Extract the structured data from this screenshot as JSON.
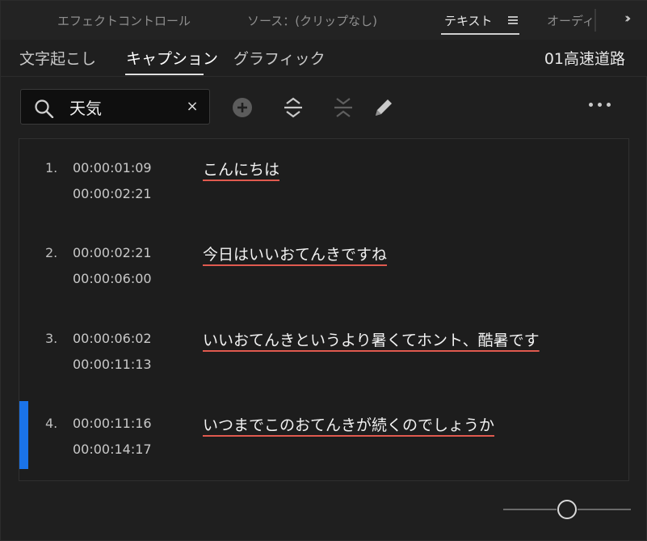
{
  "panel_tabs": {
    "items": [
      {
        "label": "エフェクトコントロール"
      },
      {
        "label": "ソース：(クリップなし)"
      },
      {
        "label": "テキスト"
      },
      {
        "label": "オーディ"
      }
    ],
    "active_index": 2
  },
  "sub_tabs": {
    "items": [
      {
        "label": "文字起こし"
      },
      {
        "label": "キャプション"
      },
      {
        "label": "グラフィック"
      }
    ],
    "active_index": 1
  },
  "sequence_name": "01高速道路",
  "search": {
    "value": "天気",
    "clear_glyph": "×"
  },
  "toolbar_icons": [
    "add-caption-icon",
    "split-caption-icon",
    "merge-captions-icon",
    "edit-icon",
    "more-options-icon"
  ],
  "captions": [
    {
      "num": "1.",
      "in": "00:00:01:09",
      "out": "00:00:02:21",
      "text": "こんにちは",
      "selected": false
    },
    {
      "num": "2.",
      "in": "00:00:02:21",
      "out": "00:00:06:00",
      "text": "今日はいいおてんきですね",
      "selected": false
    },
    {
      "num": "3.",
      "in": "00:00:06:02",
      "out": "00:00:11:13",
      "text": "いいおてんきというより暑くてホント、酷暑です",
      "selected": false
    },
    {
      "num": "4.",
      "in": "00:00:11:16",
      "out": "00:00:14:17",
      "text": "いつまでこのおてんきが続くのでしょうか",
      "selected": true
    }
  ],
  "colors": {
    "selection": "#1a73e8",
    "search_underline": "#e05a4f"
  }
}
